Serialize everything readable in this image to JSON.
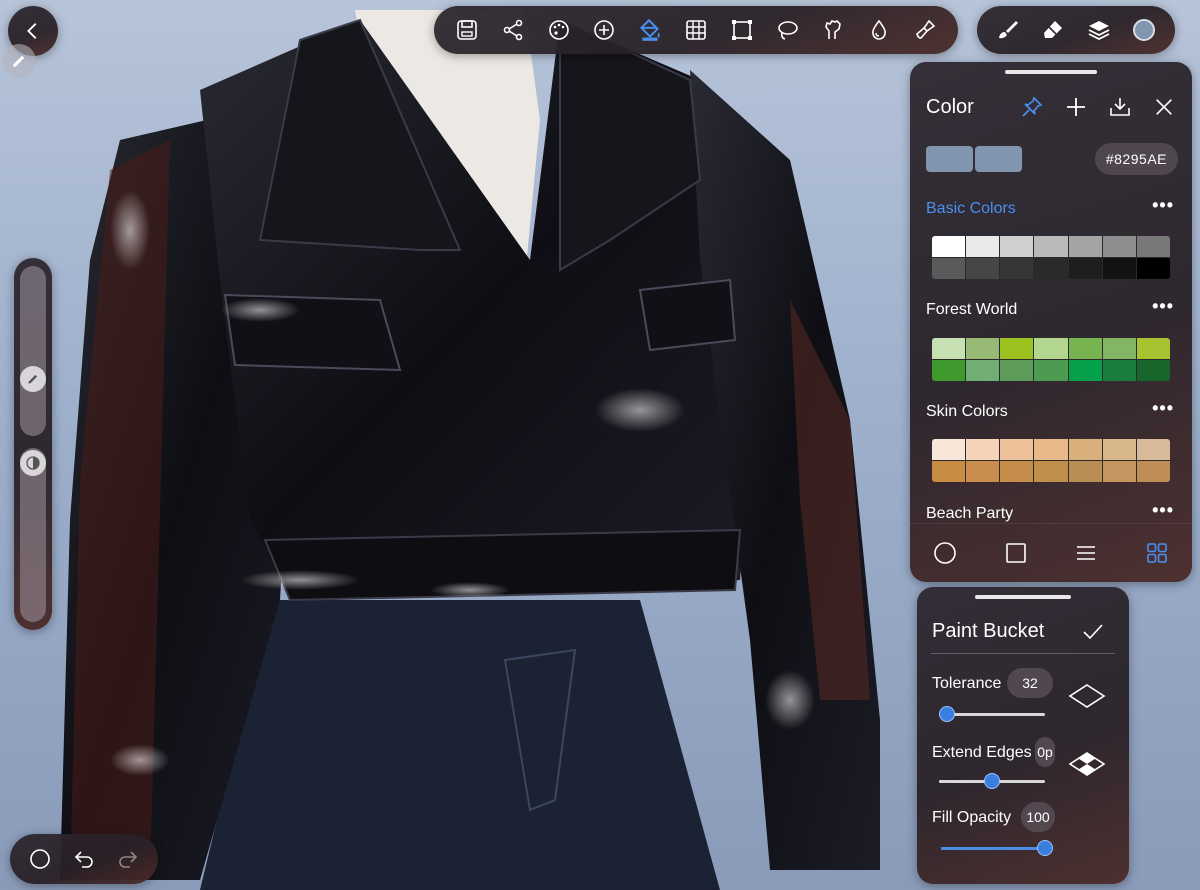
{
  "colors": {
    "accent": "#4A90F0",
    "current": "#8295AE",
    "panel": "#2C262E",
    "jacket": "#141419",
    "pants": "#1B2233",
    "shirt": "#EEE9E4"
  },
  "topbar": {
    "tools": [
      "save-icon",
      "share-icon",
      "palette-icon",
      "add-layer-icon",
      "paint-bucket-icon",
      "grid-icon",
      "transform-icon",
      "lasso-icon",
      "smudge-icon",
      "blur-drop-icon",
      "clear-brush-icon"
    ],
    "active_tool": "paint-bucket-icon"
  },
  "right_bar": {
    "tools": [
      "brush-icon",
      "eraser-icon",
      "layers-icon",
      "color-dot"
    ]
  },
  "color_panel": {
    "title": "Color",
    "hex": "#8295AE",
    "actions": [
      "pin-icon",
      "add-icon",
      "import-icon",
      "close-icon"
    ],
    "palettes": [
      {
        "name": "Basic Colors",
        "active": true,
        "colors": [
          "#FFFFFF",
          "#E9E9E9",
          "#D0D0D0",
          "#BABABA",
          "#A4A4A4",
          "#8E8E8E",
          "#787878",
          "#5A5A5A",
          "#464646",
          "#363636",
          "#2A2A2A",
          "#1E1E1E",
          "#121212",
          "#000000"
        ]
      },
      {
        "name": "Forest World",
        "active": false,
        "colors": [
          "#C6E0B1",
          "#98BA76",
          "#9CC21F",
          "#B2D58F",
          "#77B450",
          "#82B664",
          "#A7C32F",
          "#3F9A2E",
          "#70AE74",
          "#5C9B58",
          "#4E9A52",
          "#04A04A",
          "#1A7D3F",
          "#17662B"
        ]
      },
      {
        "name": "Skin Colors",
        "active": false,
        "colors": [
          "#F7E6D8",
          "#F4D3B8",
          "#EDC29B",
          "#E9B98A",
          "#D9B07C",
          "#D7B78A",
          "#D8B999",
          "#C98C45",
          "#C98D4E",
          "#C58D4A",
          "#C0904B",
          "#B88E55",
          "#C49560",
          "#BF8E56"
        ]
      },
      {
        "name": "Beach Party",
        "active": false,
        "colors": []
      }
    ],
    "footer": [
      "circle-picker-icon",
      "square-picker-icon",
      "list-view-icon",
      "grid-view-icon"
    ],
    "footer_active": "grid-view-icon"
  },
  "paint_bucket": {
    "title": "Paint Bucket",
    "tolerance": {
      "label": "Tolerance",
      "value": "32",
      "level": 0.08
    },
    "extend_edges": {
      "label": "Extend Edges",
      "value": "0p",
      "level": 0.5
    },
    "fill_opacity": {
      "label": "Fill Opacity",
      "value": "100",
      "level": 1.0
    }
  },
  "side_slider": {
    "size_level": 0.28,
    "opacity_level": 0.55
  },
  "bottom": {
    "tools": [
      "selection-circle-icon",
      "undo-icon",
      "redo-icon"
    ]
  }
}
